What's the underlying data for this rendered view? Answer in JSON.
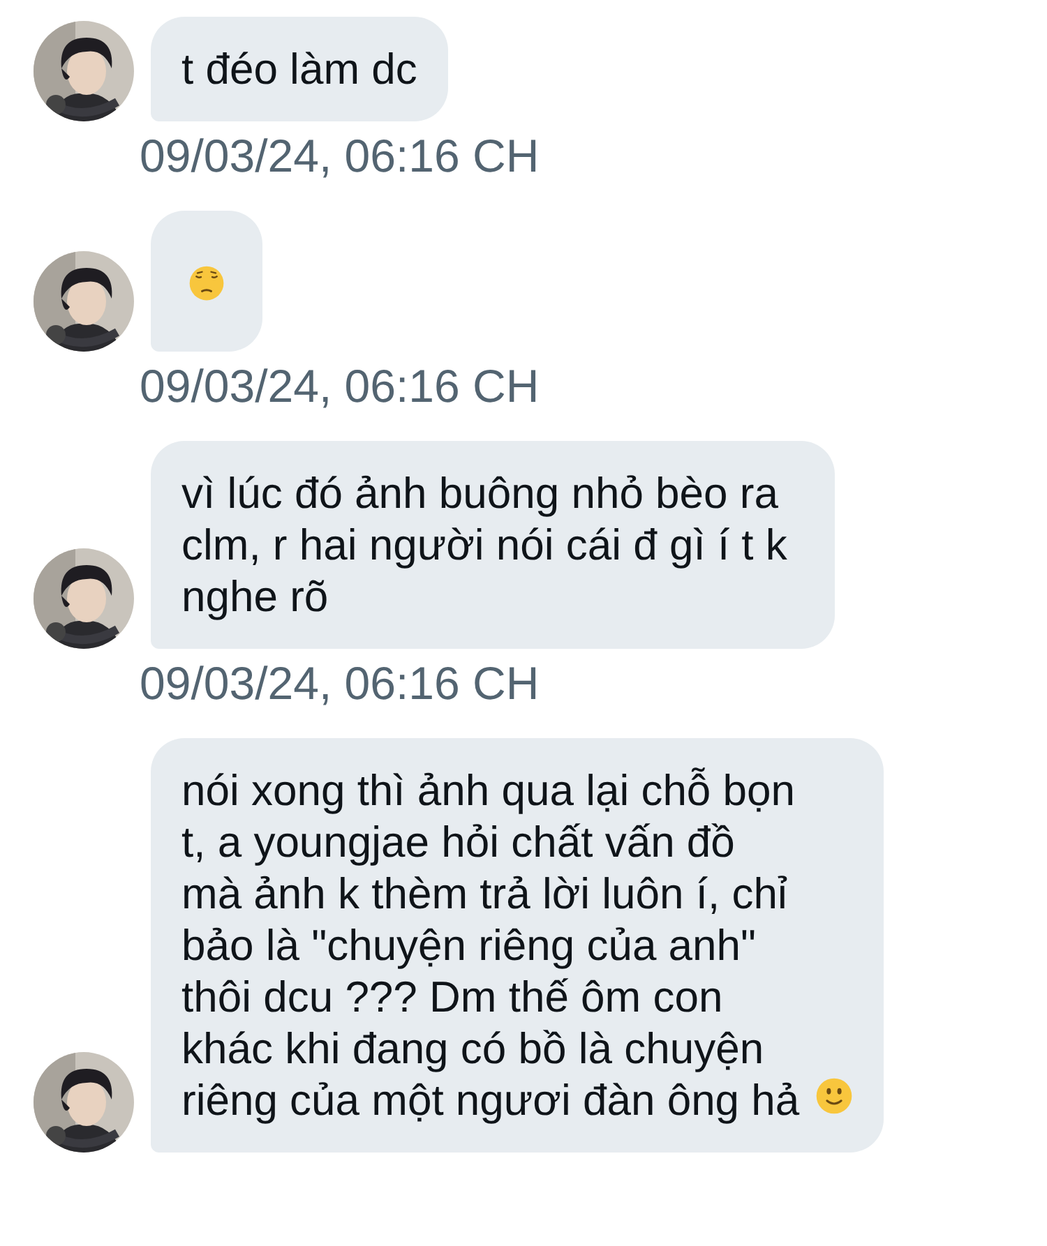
{
  "messages": [
    {
      "kind": "plain",
      "text": "t đéo làm dc",
      "timestamp": "09/03/24, 06:16 CH"
    },
    {
      "kind": "pensive",
      "timestamp": "09/03/24, 06:16 CH"
    },
    {
      "kind": "plain",
      "text": "vì lúc đó ảnh buông nhỏ bèo ra clm, r hai người nói cái đ gì í t k nghe rõ",
      "timestamp": "09/03/24, 06:16 CH"
    },
    {
      "kind": "smile",
      "text": "nói xong thì ảnh qua lại chỗ bọn t, a youngjae hỏi chất vấn đồ mà ảnh k thèm trả lời luôn í, chỉ bảo là \"chuyện riêng của anh\" thôi dcu ??? Dm thế ôm con khác khi đang có bồ là chuyện riêng của một ngươi đàn ông hả"
    }
  ]
}
